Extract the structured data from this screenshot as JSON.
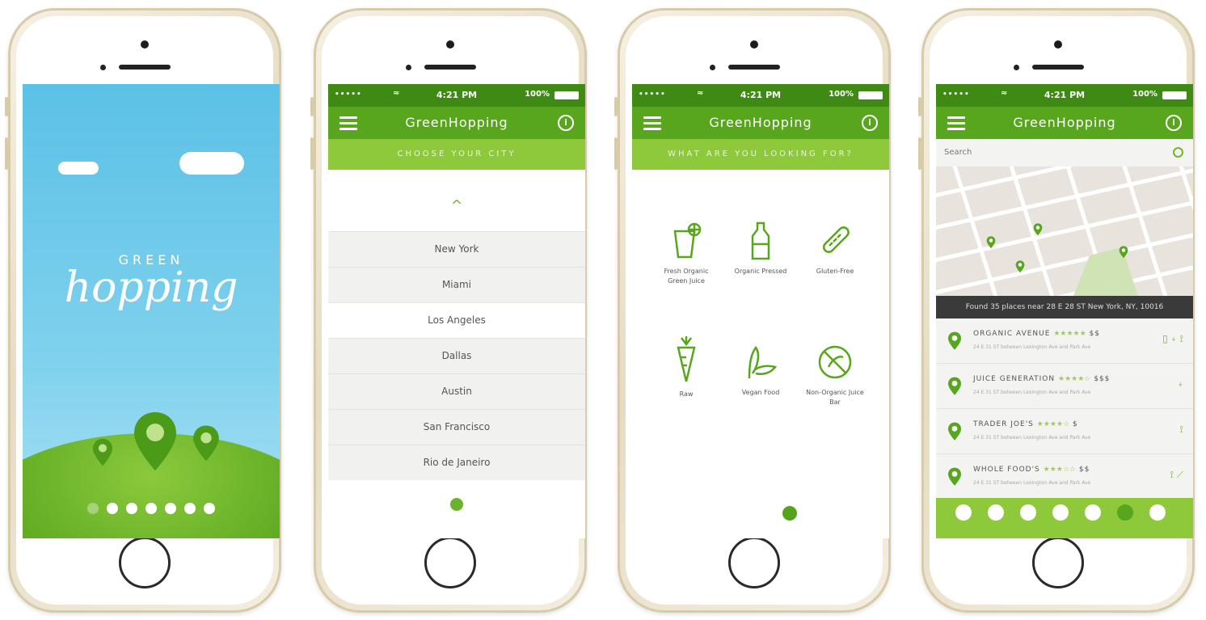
{
  "splash": {
    "brand_top": "GREEN",
    "brand_main": "hopping",
    "page_dots": 7,
    "active_dot": 0
  },
  "status": {
    "signal": "•••••",
    "wifi": "≈",
    "time": "4:21 PM",
    "battery": "100%"
  },
  "app": {
    "title": "GreenHopping",
    "info_icon": "i",
    "menu_icon": "hamburger-icon"
  },
  "city_screen": {
    "subtitle": "CHOOSE YOUR CITY",
    "up_chevron": "^",
    "cities": [
      "New York",
      "Miami",
      "Los Angeles",
      "Dallas",
      "Austin",
      "San Francisco",
      "Rio de Janeiro"
    ],
    "selected_city": "Los Angeles"
  },
  "category_screen": {
    "subtitle": "WHAT ARE YOU LOOKING FOR?",
    "categories": [
      {
        "icon": "juice-cup-icon",
        "label": "Fresh Organic Green Juice"
      },
      {
        "icon": "bottle-icon",
        "label": "Organic Pressed"
      },
      {
        "icon": "bread-icon",
        "label": "Gluten-Free"
      },
      {
        "icon": "carrot-icon",
        "label": "Raw"
      },
      {
        "icon": "leaf-icon",
        "label": "Vegan Food"
      },
      {
        "icon": "no-symbol-icon",
        "label": "Non-Organic Juice Bar"
      }
    ]
  },
  "map_screen": {
    "search_placeholder": "Search",
    "found_text": "Found 35 places near 28 E 28 ST New York, NY, 10016",
    "places": [
      {
        "name": "ORGANIC AVENUE",
        "stars": "★★★★★",
        "price": "$$",
        "address": "24 E 31 ST between Lexington Ave and Park Ave",
        "tags": "▯ ⍖ ⟟"
      },
      {
        "name": "JUICE GENERATION",
        "stars": "★★★★☆",
        "price": "$$$",
        "address": "24 E 31 ST between Lexington Ave and Park Ave",
        "tags": "⍖"
      },
      {
        "name": "TRADER JOE'S",
        "stars": "★★★★☆",
        "price": "$",
        "address": "24 E 31 ST between Lexington Ave and Park Ave",
        "tags": "⟟"
      },
      {
        "name": "WHOLE FOOD'S",
        "stars": "★★★☆☆",
        "price": "$$",
        "address": "24 E 31 ST between Lexington Ave and Park Ave",
        "tags": "⟟ ⟋"
      }
    ],
    "tabs": [
      "location-tab",
      "chat-tab",
      "heart-tab",
      "check-tab",
      "star-tab",
      "up-tab",
      "cart-tab"
    ],
    "selected_tab": 5
  },
  "colors": {
    "dark_green": "#3e8a14",
    "green": "#58a51e",
    "light_green": "#8dc93a",
    "sky": "#5bc1e6"
  }
}
